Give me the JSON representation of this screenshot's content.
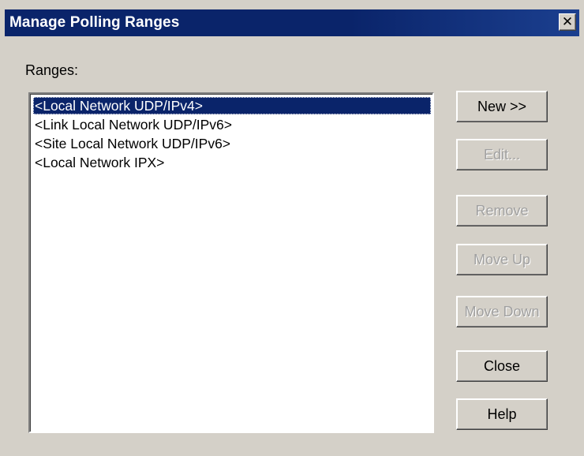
{
  "window": {
    "title": "Manage Polling Ranges",
    "close_symbol": "✕"
  },
  "ranges": {
    "label": "Ranges:",
    "items": [
      {
        "label": "<Local Network UDP/IPv4>",
        "selected": true
      },
      {
        "label": "<Link Local Network UDP/IPv6>",
        "selected": false
      },
      {
        "label": "<Site Local Network UDP/IPv6>",
        "selected": false
      },
      {
        "label": "<Local Network IPX>",
        "selected": false
      }
    ]
  },
  "buttons": {
    "new": {
      "label": "New >>",
      "enabled": true
    },
    "edit": {
      "label": "Edit...",
      "enabled": false
    },
    "remove": {
      "label": "Remove",
      "enabled": false
    },
    "move_up": {
      "label": "Move Up",
      "enabled": false
    },
    "move_down": {
      "label": "Move Down",
      "enabled": false
    },
    "close": {
      "label": "Close",
      "enabled": true
    },
    "help": {
      "label": "Help",
      "enabled": true
    }
  },
  "colors": {
    "titlebar": "#0a246a",
    "dialog_face": "#d4d0c8",
    "selection": "#0a246a",
    "disabled_text": "#a0a0a0"
  }
}
